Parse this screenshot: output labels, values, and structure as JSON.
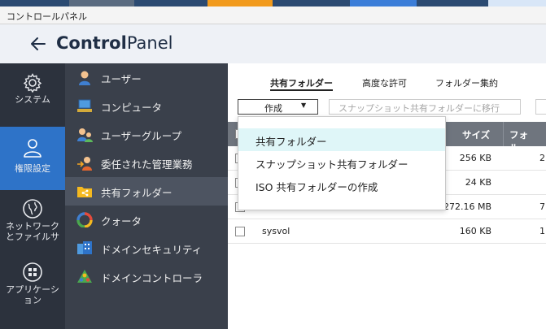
{
  "window": {
    "title": "コントロールパネル"
  },
  "header": {
    "title_bold": "Control",
    "title_light": "Panel"
  },
  "rail": {
    "items": [
      {
        "label": "システム"
      },
      {
        "label": "権限設定"
      },
      {
        "label": "ネットワーク\nとファイルサ"
      },
      {
        "label": "アプリケーシ\nョン"
      }
    ]
  },
  "submenu": {
    "items": [
      {
        "label": "ユーザー"
      },
      {
        "label": "コンピュータ"
      },
      {
        "label": "ユーザーグループ"
      },
      {
        "label": "委任された管理業務"
      },
      {
        "label": "共有フォルダー"
      },
      {
        "label": "クォータ"
      },
      {
        "label": "ドメインセキュリティ"
      },
      {
        "label": "ドメインコントローラ"
      }
    ]
  },
  "tabs": [
    {
      "label": "共有フォルダー"
    },
    {
      "label": "高度な許可"
    },
    {
      "label": "フォルダー集約"
    }
  ],
  "toolbar": {
    "create_label": "作成",
    "snapshot_label": "スナップショット共有フォルダーに移行"
  },
  "table": {
    "headers": {
      "size": "サイズ",
      "folder": "フォル..."
    },
    "rows": [
      {
        "name": "",
        "size": "256 KB",
        "folder": "2"
      },
      {
        "name": "",
        "size": "24 KB",
        "folder": ""
      },
      {
        "name": "",
        "size": "272.16 MB",
        "folder": "7"
      },
      {
        "name": "sysvol",
        "size": "160 KB",
        "folder": "1"
      }
    ]
  },
  "dropdown": {
    "items": [
      {
        "label": "共有フォルダー"
      },
      {
        "label": "スナップショット共有フォルダー"
      },
      {
        "label": "ISO 共有フォルダーの作成"
      }
    ]
  },
  "colors": {
    "rail_bg": "#2c323d",
    "rail_active": "#2e73c8",
    "submenu_bg": "#3a404b",
    "submenu_active": "#4d5461",
    "table_header": "#6f757e",
    "dropdown_hover": "#dff6f8"
  }
}
